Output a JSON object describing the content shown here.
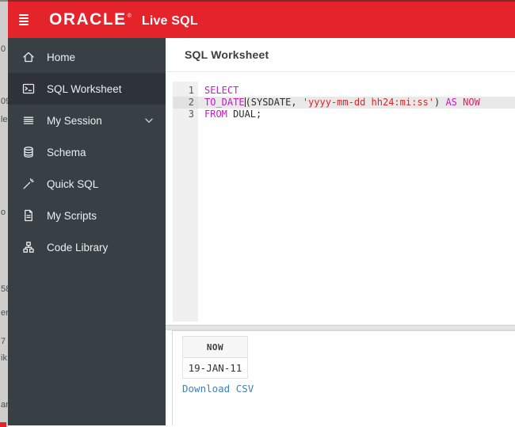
{
  "header": {
    "brand": "ORACLE",
    "registered_mark": "®",
    "app_name": "Live SQL"
  },
  "sidebar": {
    "items": [
      {
        "label": "Home",
        "icon": "home-icon",
        "selected": false
      },
      {
        "label": "SQL Worksheet",
        "icon": "terminal-icon",
        "selected": true
      },
      {
        "label": "My Session",
        "icon": "list-icon",
        "selected": false,
        "expandable": true
      },
      {
        "label": "Schema",
        "icon": "database-icon",
        "selected": false
      },
      {
        "label": "Quick SQL",
        "icon": "wand-icon",
        "selected": false
      },
      {
        "label": "My Scripts",
        "icon": "document-icon",
        "selected": false
      },
      {
        "label": "Code Library",
        "icon": "hierarchy-icon",
        "selected": false
      }
    ]
  },
  "main": {
    "title": "SQL Worksheet"
  },
  "editor": {
    "active_line": 2,
    "lines": [
      {
        "number": 1,
        "tokens": [
          {
            "text": "SELECT",
            "type": "keyword"
          }
        ]
      },
      {
        "number": 2,
        "tokens": [
          {
            "text": "TO_DATE",
            "type": "keyword"
          },
          {
            "text": "(SYSDATE, ",
            "type": "plain"
          },
          {
            "text": "'yyyy-mm-dd hh24:mi:ss'",
            "type": "string"
          },
          {
            "text": ") ",
            "type": "plain"
          },
          {
            "text": "AS",
            "type": "keyword"
          },
          {
            "text": " ",
            "type": "plain"
          },
          {
            "text": "NOW",
            "type": "alias"
          }
        ]
      },
      {
        "number": 3,
        "tokens": [
          {
            "text": "FROM",
            "type": "keyword"
          },
          {
            "text": " DUAL;",
            "type": "plain"
          }
        ]
      }
    ]
  },
  "results": {
    "columns": [
      "NOW"
    ],
    "rows": [
      [
        "19-JAN-11"
      ]
    ],
    "download_label": "Download CSV"
  },
  "background_fragments": [
    {
      "text": "0"
    },
    {
      "text": "09"
    },
    {
      "text": "le"
    },
    {
      "text": "o"
    },
    {
      "text": "58"
    },
    {
      "text": "en"
    },
    {
      "text": "7"
    },
    {
      "text": "ik"
    },
    {
      "text": "ar"
    }
  ],
  "colors": {
    "topbar_red": "#e5232b",
    "topbar_top_edge": "#7c2a26",
    "sidebar_bg": "#394045",
    "sidebar_selected_bg": "#2d3338",
    "keyword": "#c617c6",
    "string": "#dd2626",
    "alias": "#e51c65",
    "active_line_bg": "#e9e9e9",
    "link_blue": "#3e7fbb"
  }
}
